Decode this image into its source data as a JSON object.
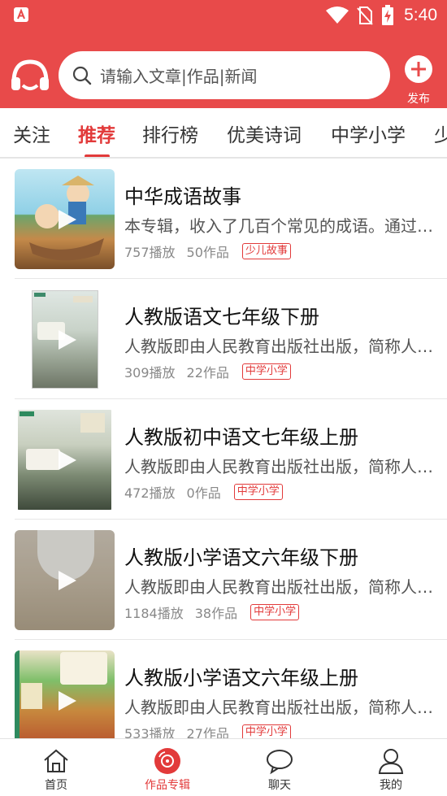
{
  "status_bar": {
    "time": "5:40",
    "app_icon": "app-a-icon",
    "icons": [
      "wifi-icon",
      "no-sim-icon",
      "battery-charging-icon"
    ]
  },
  "header": {
    "logo_icon": "headphones-logo-icon",
    "search": {
      "placeholder": "请输入文章|作品|新闻",
      "icon": "search-icon"
    },
    "publish": {
      "label": "发布",
      "icon": "plus-circle-icon"
    }
  },
  "tabs": [
    {
      "label": "关注",
      "active": false
    },
    {
      "label": "推荐",
      "active": true
    },
    {
      "label": "排行榜",
      "active": false
    },
    {
      "label": "优美诗词",
      "active": false
    },
    {
      "label": "中学小学",
      "active": false
    },
    {
      "label": "少",
      "active": false
    }
  ],
  "items": [
    {
      "title": "中华成语故事",
      "desc": "本专辑，收入了几百个常见的成语。通过生动有趣的故事",
      "plays": "757播放",
      "works": "50作品",
      "tag": "少儿故事"
    },
    {
      "title": "人教版语文七年级下册",
      "desc": "人教版即由人民教育出版社出版，简称人教版",
      "plays": "309播放",
      "works": "22作品",
      "tag": "中学小学"
    },
    {
      "title": "人教版初中语文七年级上册",
      "desc": "人教版即由人民教育出版社出版，简称人教版",
      "plays": "472播放",
      "works": "0作品",
      "tag": "中学小学"
    },
    {
      "title": "人教版小学语文六年级下册",
      "desc": "人教版即由人民教育出版社出版，简称人教版",
      "plays": "1184播放",
      "works": "38作品",
      "tag": "中学小学"
    },
    {
      "title": "人教版小学语文六年级上册",
      "desc": "人教版即由人民教育出版社出版，简称人教版",
      "plays": "533播放",
      "works": "27作品",
      "tag": "中学小学"
    }
  ],
  "bottom_nav": [
    {
      "label": "首页",
      "icon": "home-icon",
      "active": false
    },
    {
      "label": "作品专辑",
      "icon": "album-disc-icon",
      "active": true
    },
    {
      "label": "聊天",
      "icon": "chat-bubble-icon",
      "active": false
    },
    {
      "label": "我的",
      "icon": "user-icon",
      "active": false
    }
  ],
  "colors": {
    "brand_red": "#e84a4a",
    "accent_red": "#e23a3a"
  }
}
